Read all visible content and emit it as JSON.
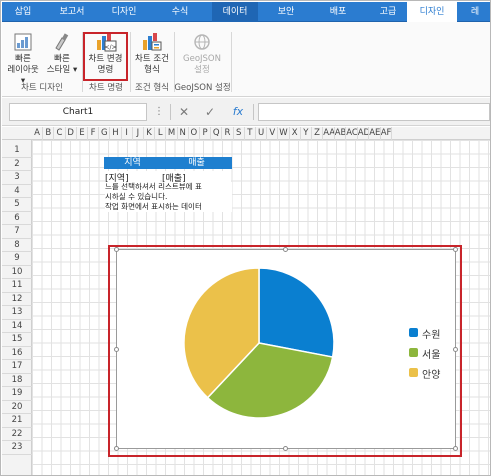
{
  "ribbon_tabs": [
    "삽입",
    "보고서",
    "디자인",
    "수식",
    "데이터",
    "보안",
    "배포",
    "고급",
    "디자인",
    "레"
  ],
  "active_tab_index": 8,
  "accent_tab_index": 4,
  "ribbon": {
    "quick_layout": [
      "빠른",
      "레이아웃 ▾"
    ],
    "quick_style": [
      "빠른",
      "스타일 ▾"
    ],
    "chart_change": [
      "차트 변경",
      "명령"
    ],
    "chart_condition": [
      "차트 조건",
      "형식"
    ],
    "geojson_setting": [
      "GeoJSON",
      "설정"
    ],
    "groups": [
      "차트 디자인",
      "차트 명령",
      "조건 형식",
      "GeoJSON 설정"
    ]
  },
  "formula_bar": {
    "name_box": "Chart1",
    "more_icon": "⋮",
    "cancel_icon": "✕",
    "confirm_icon": "✓",
    "fx_label": "fx",
    "formula": ""
  },
  "columns": [
    "A",
    "B",
    "C",
    "D",
    "E",
    "F",
    "G",
    "H",
    "I",
    "J",
    "K",
    "L",
    "M",
    "N",
    "O",
    "P",
    "Q",
    "R",
    "S",
    "T",
    "U",
    "V",
    "W",
    "X",
    "Y",
    "Z",
    "AA",
    "AB",
    "AC",
    "AD",
    "AE",
    "AF"
  ],
  "rows": [
    "1",
    "2",
    "3",
    "4",
    "5",
    "6",
    "7",
    "8",
    "9",
    "10",
    "11",
    "12",
    "13",
    "14",
    "15",
    "16",
    "17",
    "18",
    "19",
    "20",
    "21",
    "22",
    "23"
  ],
  "table": {
    "header_region": "지역",
    "header_sales": "매출",
    "cell_region": "[지역]",
    "cell_sales": "[매출]",
    "note_lines": [
      "느를 선택하셔서 리스트뷰에 표",
      "시하실 수 있습니다.",
      "작업 화면에서 표시하는 데이터"
    ]
  },
  "chart_data": {
    "type": "pie",
    "categories": [
      "수원",
      "서울",
      "안양"
    ],
    "values": [
      28,
      34,
      38
    ],
    "colors": [
      "#0a7fd0",
      "#8db63d",
      "#ebc14a"
    ],
    "legend": "right"
  },
  "highlight_color": "#c8242a"
}
